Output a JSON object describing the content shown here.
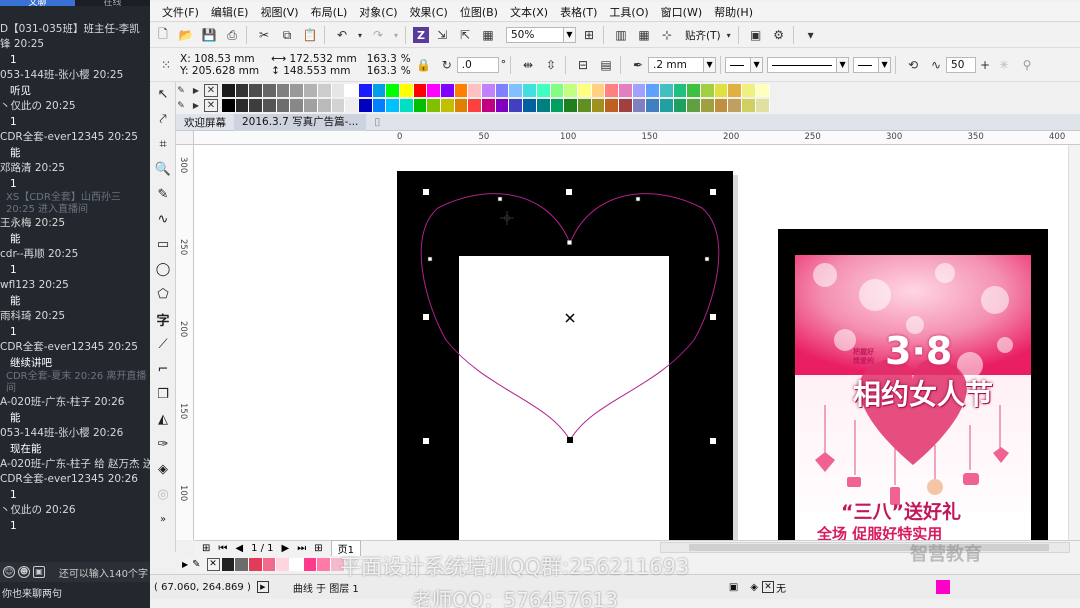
{
  "chat": {
    "tabs": [
      "文聊",
      "在线"
    ],
    "messages": [
      {
        "user": "D【031-035班】班主任-李凯",
        "text": "",
        "sys": false
      },
      {
        "user": "锋 20:25",
        "text": "1",
        "sys": false
      },
      {
        "user": "053-144班-张小樱 20:25",
        "text": "听见",
        "sys": false
      },
      {
        "user": "丶仅此の 20:25",
        "text": "1",
        "sys": false
      },
      {
        "user": "CDR全套-ever12345 20:25",
        "text": "能",
        "sys": false
      },
      {
        "user": "邓路清 20:25",
        "text": "1",
        "sys": false
      },
      {
        "user": "XS【CDR全套】山西孙三 20:25 进入直播间",
        "text": "",
        "sys": true
      },
      {
        "user": "王永梅 20:25",
        "text": "能",
        "sys": false
      },
      {
        "user": "cdr--再顺 20:25",
        "text": "1",
        "sys": false
      },
      {
        "user": "wfl123 20:25",
        "text": "能",
        "sys": false
      },
      {
        "user": "雨科琦 20:25",
        "text": "1",
        "sys": false
      },
      {
        "user": "CDR全套-ever12345 20:25",
        "text": "继续讲吧",
        "sys": false
      },
      {
        "user": "CDR全套-夏末 20:26 离开直播间",
        "text": "",
        "sys": true
      },
      {
        "user": "A-020班-广东-柱子 20:26",
        "text": "能",
        "sys": false
      },
      {
        "user": "053-144班-张小樱 20:26",
        "text": "现在能",
        "sys": false
      },
      {
        "user": "A-020班-广东-柱子 给 赵万杰 送了 ❤",
        "text": "",
        "sys": false
      },
      {
        "user": "CDR全套-ever12345 20:26",
        "text": "1",
        "sys": false
      },
      {
        "user": "丶仅此の 20:26",
        "text": "1",
        "sys": false
      }
    ],
    "footer_hint": "还可以输入140个字",
    "input_text": "你也来聊两句"
  },
  "menu": [
    "文件(F)",
    "编辑(E)",
    "视图(V)",
    "布局(L)",
    "对象(C)",
    "效果(C)",
    "位图(B)",
    "文本(X)",
    "表格(T)",
    "工具(O)",
    "窗口(W)",
    "帮助(H)"
  ],
  "toolbar": {
    "zoom": "50%",
    "snap_label": "贴齐(T)"
  },
  "props": {
    "x": "X: 108.53 mm",
    "y": "Y: 205.628 mm",
    "w": "172.532 mm",
    "h": "148.553 mm",
    "sx": "163.3",
    "sy": "163.3",
    "pct": "%",
    "angle": ".0",
    "deg": "°",
    "outline": ".2 mm",
    "nodes": "50"
  },
  "palette_top": [
    "#1a1a1a",
    "#333333",
    "#4d4d4d",
    "#666666",
    "#808080",
    "#999999",
    "#b3b3b3",
    "#cccccc",
    "#e6e6e6",
    "#ffffff",
    "#1a1aff",
    "#00a0e9",
    "#00ff00",
    "#ffff00",
    "#ff0000",
    "#ff00ff",
    "#8000ff",
    "#ff8000",
    "#ffc0c0",
    "#c080ff",
    "#8080ff",
    "#80c0ff",
    "#40e0e0",
    "#40ffc0",
    "#80ff80",
    "#c0ff80",
    "#ffff80",
    "#ffd080",
    "#ff8080",
    "#e080c0",
    "#a0a0ff",
    "#60a0ff",
    "#40c0c0",
    "#20c080",
    "#40c040",
    "#a0d040",
    "#e0e040",
    "#e0b040",
    "#f0f080",
    "#ffffc0"
  ],
  "palette_bottom": [
    "#000000",
    "#2a2a2a",
    "#3d3d3d",
    "#555555",
    "#6e6e6e",
    "#888888",
    "#a1a1a1",
    "#bababa",
    "#d3d3d3",
    "#eeeeee",
    "#0000c0",
    "#0080ff",
    "#00c0ff",
    "#00e0c0",
    "#00c000",
    "#80c000",
    "#c0c000",
    "#e08000",
    "#ff4040",
    "#c00080",
    "#8000c0",
    "#4040c0",
    "#0060a0",
    "#008080",
    "#00a060",
    "#208020",
    "#609020",
    "#a09020",
    "#c06020",
    "#a04040",
    "#8080c0",
    "#4080c0",
    "#20a0a0",
    "#20a060",
    "#60a040",
    "#a0a040",
    "#c09040",
    "#c0a060",
    "#d0d060",
    "#e0e0a0"
  ],
  "doc_tabs": [
    "欢迎屏幕",
    "2016.3.7 写真广告篇-..."
  ],
  "ruler_h": [
    "0",
    "50",
    "100",
    "150",
    "200",
    "250",
    "300",
    "350",
    "400"
  ],
  "ruler_v": [
    "300",
    "250",
    "200",
    "150",
    "100"
  ],
  "page_nav": {
    "current": "1 / 1",
    "tab": "页1"
  },
  "doc_palette": [
    "#222222",
    "#6c6c6c",
    "#e23b5a",
    "#f06a8c",
    "#ffd5e0",
    "#ffffff",
    "#ff3a8c",
    "#ff7aa8",
    "#f5b9cc",
    "#eeeeee"
  ],
  "status": {
    "coords": "( 67.060, 264.869 )",
    "object": "曲线 于 图层 1",
    "fill_none": "无"
  },
  "watermark": {
    "line1": "平面设计系统培训QQ群:256211693",
    "line2": "老师QQ：576457613",
    "logo": "智营教育"
  },
  "poster": {
    "small1": "把握好",
    "small2": "情爱的",
    "date": "3·8",
    "title": "相约女人节",
    "slogan": "“三八”送好礼",
    "bottom": "全场   促服好特实用"
  }
}
